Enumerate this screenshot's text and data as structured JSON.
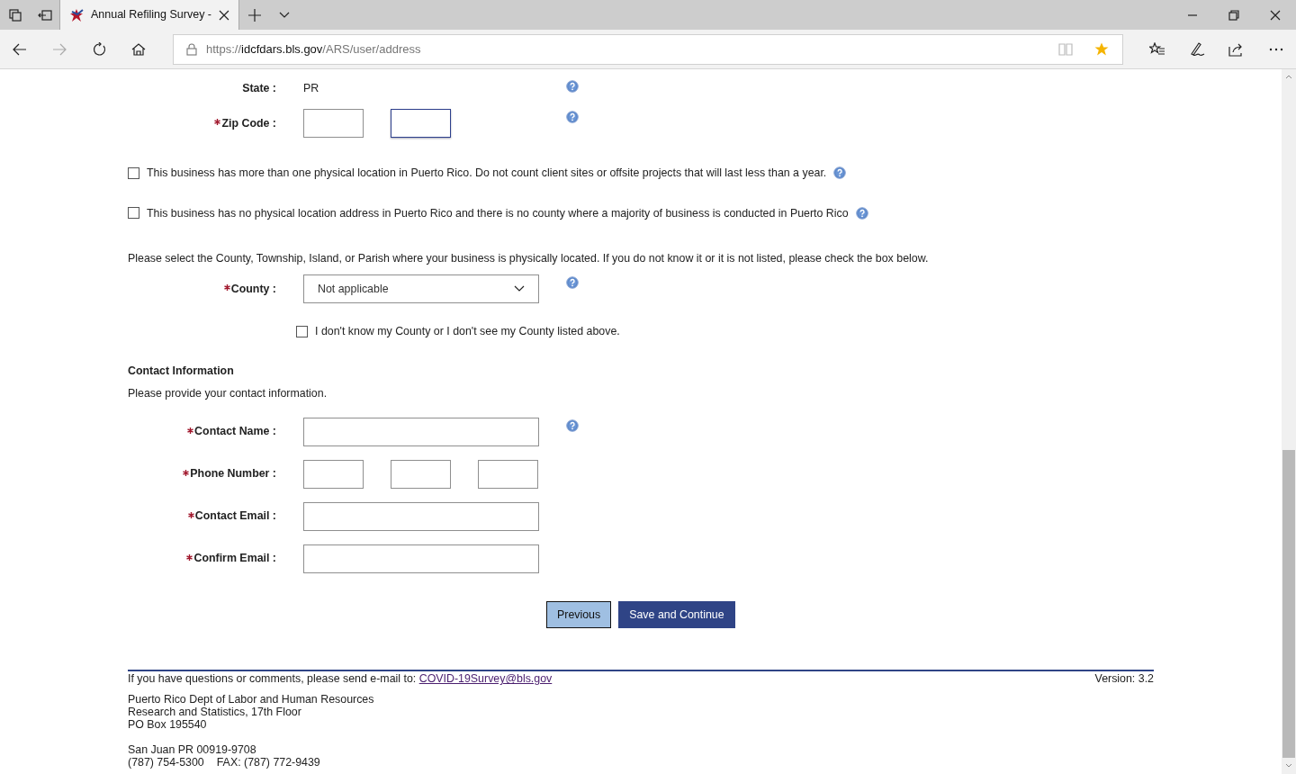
{
  "browser": {
    "tab_title": "Annual Refiling Survey -",
    "url_scheme": "https://",
    "url_host": "idcfdars.bls.gov",
    "url_path": "/ARS/user/address",
    "favorited": true,
    "forward_disabled": true
  },
  "address_fields": [
    {
      "label": "State :",
      "required": false,
      "kind": "text",
      "value": "PR",
      "help": true
    },
    {
      "label": "Zip Code :",
      "required": true,
      "kind": "inputs",
      "inputs": [
        {
          "focused": false
        },
        {
          "focused": true
        }
      ],
      "help": true
    }
  ],
  "location_checkboxes": [
    {
      "label": "This business has more than one physical location in Puerto Rico. Do not count client sites or offsite projects that will last less than a year.",
      "checked": false,
      "help": true
    },
    {
      "label": "This business has no physical location address in Puerto Rico and there is no county where a majority of business is conducted in Puerto Rico",
      "checked": false,
      "help": true
    }
  ],
  "county_prompt": "Please select the County, Township, Island, or Parish where your business is physically located. If you do not know it or it is not listed, please check the box below.",
  "county": {
    "label": "County :",
    "required": true,
    "value": "Not applicable",
    "help": true
  },
  "county_unknown": {
    "label": "I don't know my County or I don't see my County listed above.",
    "checked": false
  },
  "contact": {
    "heading": "Contact Information",
    "subtext": "Please provide your contact information.",
    "fields": [
      {
        "label": "Contact Name :",
        "required": true,
        "inputs": [
          {
            "focused": false
          }
        ],
        "help": true
      },
      {
        "label": "Phone Number :",
        "required": true,
        "inputs": [
          {
            "focused": false
          },
          {
            "focused": false
          },
          {
            "focused": false
          }
        ],
        "help": false
      },
      {
        "label": "Contact Email :",
        "required": true,
        "inputs": [
          {
            "focused": false
          }
        ],
        "help": false
      },
      {
        "label": "Confirm Email :",
        "required": true,
        "inputs": [
          {
            "focused": false
          }
        ],
        "help": false
      }
    ]
  },
  "buttons": [
    {
      "label": "Previous",
      "kind": "secondary"
    },
    {
      "label": "Save and Continue",
      "kind": "primary"
    }
  ],
  "footer": {
    "contact_text": "If you have questions or comments, please send e-mail to:",
    "email": "COVID-19Survey@bls.gov",
    "version": "Version: 3.2",
    "address_lines": [
      "Puerto Rico Dept of Labor and Human Resources",
      "Research and Statistics, 17th Floor",
      "PO Box 195540"
    ],
    "city_line": "San Juan PR 00919-9708",
    "phone": "(787) 754-5300",
    "fax": "FAX: (787) 772-9439"
  }
}
